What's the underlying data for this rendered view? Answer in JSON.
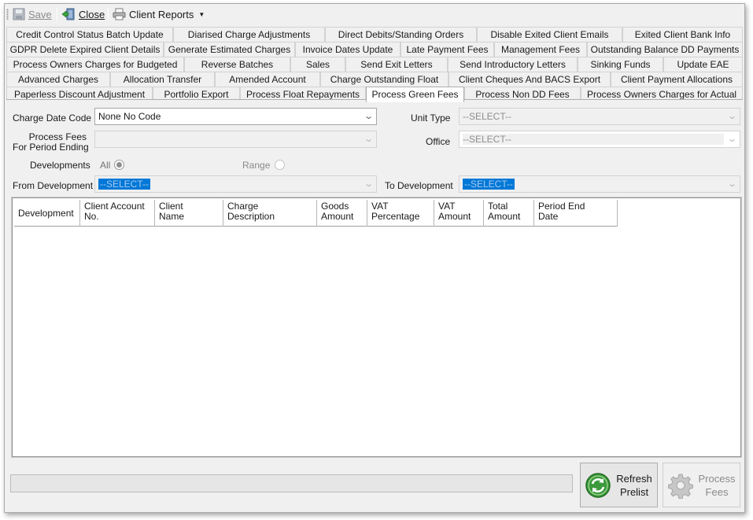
{
  "toolbar": {
    "save_label": "Save",
    "close_label": "Close",
    "client_reports_label": "Client Reports"
  },
  "tabs": {
    "row1": [
      "Credit Control Status Batch Update",
      "Diarised Charge Adjustments",
      "Direct Debits/Standing Orders",
      "Disable Exited Client Emails",
      "Exited Client Bank Info"
    ],
    "row2": [
      "GDPR Delete Expired Client Details",
      "Generate Estimated Charges",
      "Invoice Dates Update",
      "Late Payment Fees",
      "Management Fees",
      "Outstanding Balance DD Payments"
    ],
    "row3": [
      "Process Owners Charges for Budgeted",
      "Reverse  Batches",
      "Sales",
      "Send Exit Letters",
      "Send Introductory Letters",
      "Sinking Funds",
      "Update EAE"
    ],
    "row4": [
      "Advanced Charges",
      "Allocation Transfer",
      "Amended Account",
      "Charge Outstanding Float",
      "Client Cheques And BACS Export",
      "Client Payment Allocations"
    ],
    "row5": [
      "Paperless Discount Adjustment",
      "Portfolio Export",
      "Process Float Repayments",
      "Process Green Fees",
      "Process Non DD Fees",
      "Process Owners Charges for Actual"
    ],
    "active": "Process Green Fees"
  },
  "form": {
    "charge_date_code_label": "Charge Date Code",
    "charge_date_code_value": "None No Code",
    "unit_type_label": "Unit Type",
    "unit_type_value": "--SELECT--",
    "process_fees_label_line1": "Process Fees",
    "process_fees_label_line2": "For Period Ending",
    "process_fees_value": "",
    "office_label": "Office",
    "office_value": "--SELECT--",
    "developments_label": "Developments",
    "all_label": "All",
    "range_label": "Range",
    "from_development_label": "From Development",
    "from_development_value": "--SELECT--",
    "to_development_label": "To Development",
    "to_development_value": "--SELECT--"
  },
  "grid": {
    "columns": [
      {
        "l1": "Development",
        "l2": ""
      },
      {
        "l1": "Client Account",
        "l2": "No."
      },
      {
        "l1": "Client",
        "l2": "Name"
      },
      {
        "l1": "Charge",
        "l2": "Description"
      },
      {
        "l1": "Goods",
        "l2": "Amount"
      },
      {
        "l1": "VAT",
        "l2": "Percentage"
      },
      {
        "l1": "VAT",
        "l2": "Amount"
      },
      {
        "l1": "Total",
        "l2": "Amount"
      },
      {
        "l1": "Period End",
        "l2": "Date"
      }
    ]
  },
  "buttons": {
    "refresh_l1": "Refresh",
    "refresh_l2": "Prelist",
    "process_l1": "Process",
    "process_l2": "Fees"
  },
  "colors": {
    "selection_blue": "#0078d7",
    "refresh_green": "#3c9a3c"
  }
}
